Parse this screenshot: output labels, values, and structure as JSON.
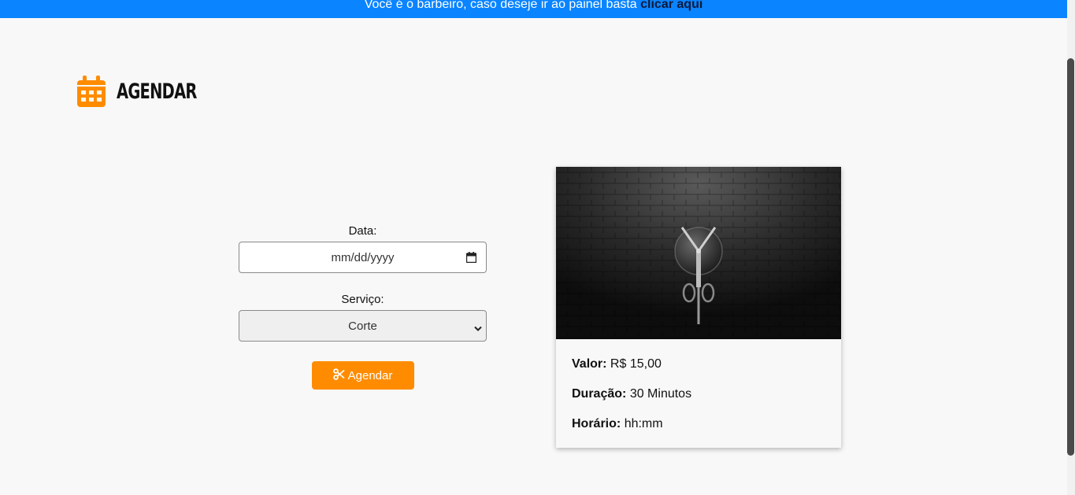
{
  "banner": {
    "text": "Você é o barbeiro, caso deseje ir ao painel basta ",
    "link": "clicar aqui"
  },
  "header": {
    "icon": "calendar-icon",
    "title": "AGENDAR",
    "accent_color": "#ff8c00"
  },
  "form": {
    "date_label": "Data:",
    "date_placeholder": "mm/dd/yyyy",
    "service_label": "Serviço:",
    "service_selected": "Corte",
    "submit_label": "Agendar",
    "submit_icon": "scissors-icon"
  },
  "card": {
    "image": "barber-scissors-image",
    "valor_label": "Valor:",
    "valor_value": "R$ 15,00",
    "duracao_label": "Duração:",
    "duracao_value": "30 Minutos",
    "horario_label": "Horário:",
    "horario_value": "hh:mm"
  },
  "colors": {
    "banner_bg": "#0a84ff",
    "button_bg": "#ff8c00",
    "page_bg": "#f8f8f8"
  }
}
